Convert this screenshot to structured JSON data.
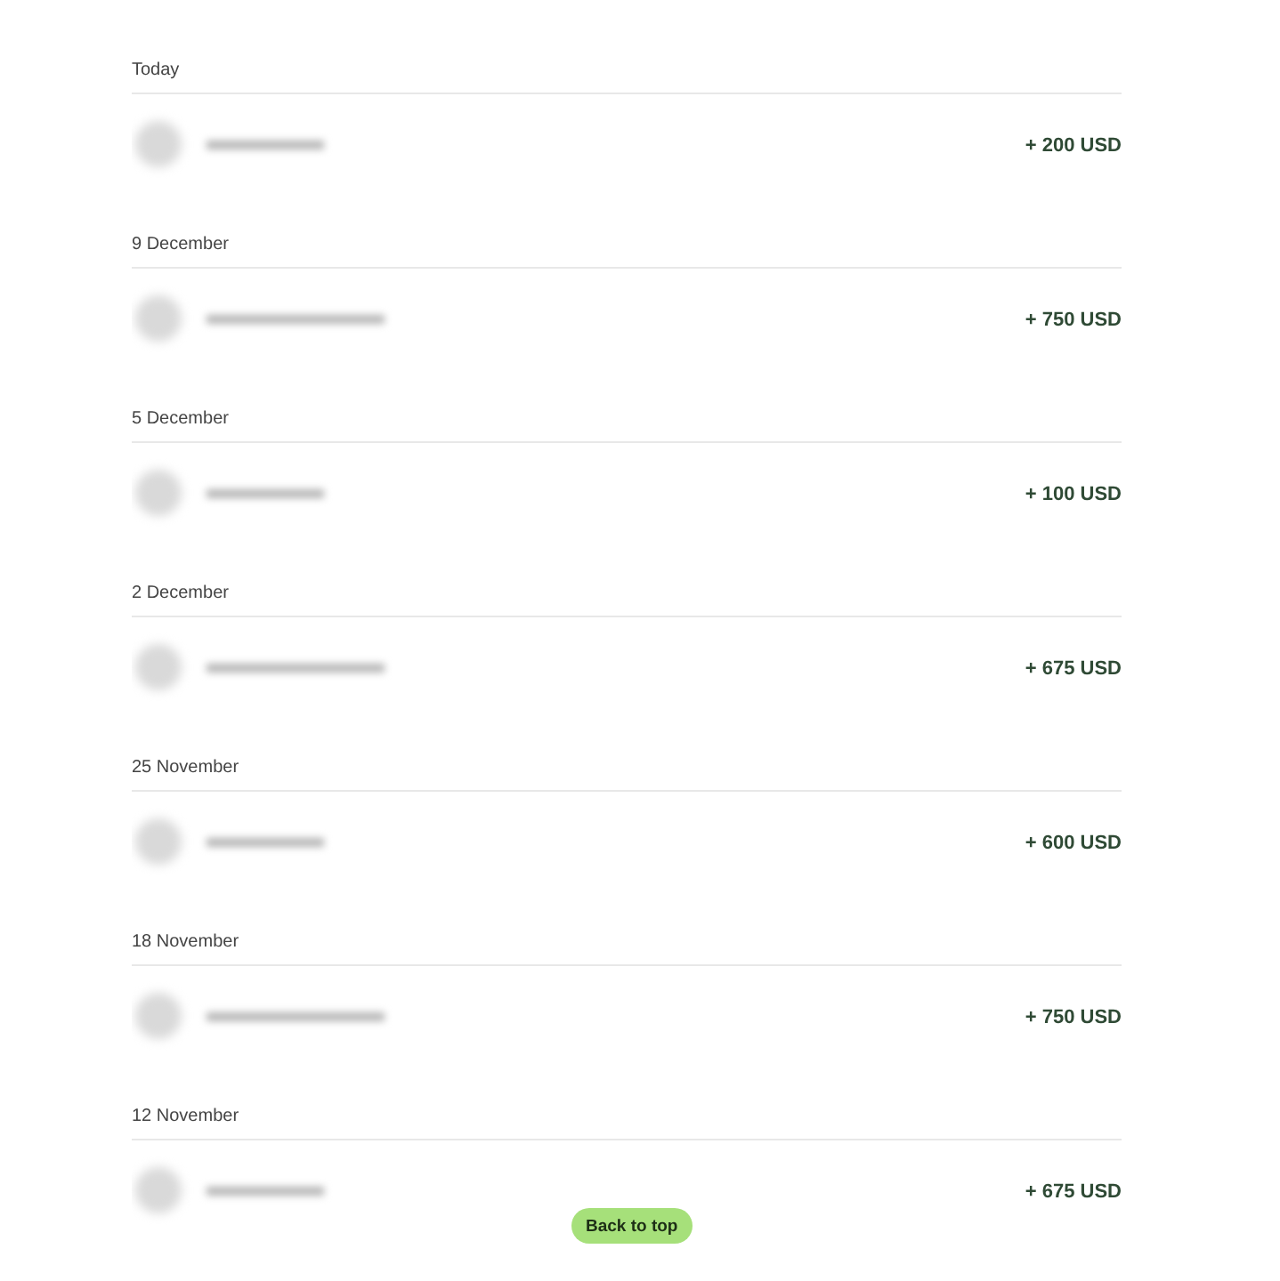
{
  "groups": [
    {
      "date": "Today",
      "amount": "+ 200 USD"
    },
    {
      "date": "9 December",
      "amount": "+ 750 USD"
    },
    {
      "date": "5 December",
      "amount": "+ 100 USD"
    },
    {
      "date": "2 December",
      "amount": "+ 675 USD"
    },
    {
      "date": "25 November",
      "amount": "+ 600 USD"
    },
    {
      "date": "18 November",
      "amount": "+ 750 USD"
    },
    {
      "date": "12 November",
      "amount": "+ 675 USD"
    }
  ],
  "back_to_top": "Back to top"
}
